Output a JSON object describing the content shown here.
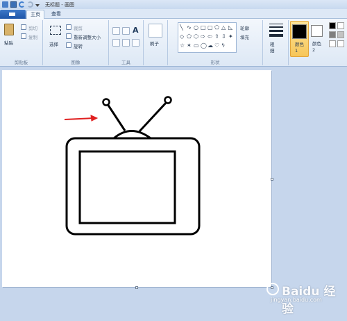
{
  "window": {
    "title": "无标题 - 画图"
  },
  "tabs": [
    {
      "label": "主页",
      "active": true
    },
    {
      "label": "查看",
      "active": false
    }
  ],
  "ribbon": {
    "clipboard": {
      "group_label": "剪贴板",
      "paste_label": "粘贴",
      "cut_label": "剪切",
      "copy_label": "复制"
    },
    "image": {
      "group_label": "图像",
      "select_label": "选择",
      "crop_label": "裁剪",
      "resize_label": "重新调整大小",
      "rotate_label": "旋转"
    },
    "tools": {
      "group_label": "工具",
      "text_tool": "A"
    },
    "brushes": {
      "label": "刷子"
    },
    "shapes": {
      "group_label": "形状",
      "outline_label": "轮廓",
      "fill_label": "填充"
    },
    "size": {
      "label": "粗细"
    },
    "color1": {
      "label": "颜色 1",
      "color": "#000000"
    },
    "color2": {
      "label": "颜色 2",
      "color": "#ffffff"
    },
    "palette": [
      "#000000",
      "#ffffff",
      "#7f7f7f",
      "#c3c3c3"
    ]
  },
  "drawing": {
    "arrow_color": "#e02020",
    "stroke_color": "#000000"
  },
  "watermark": {
    "text": "Baidu 经验",
    "url": "jingyan.baidu.com"
  }
}
